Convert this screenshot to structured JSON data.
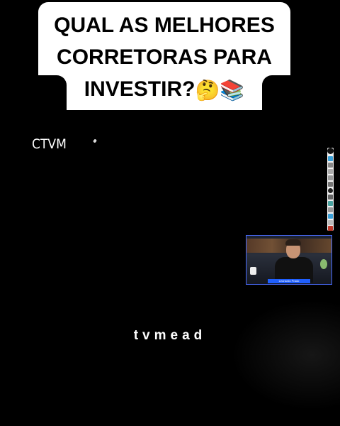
{
  "caption": {
    "line1": "QUAL AS MELHORES",
    "line2": "CORRETORAS PARA",
    "line3": "INVESTIR?",
    "emojis": "🤔📚"
  },
  "handwriting": {
    "text": "CTVM"
  },
  "webcam": {
    "nameplate": "Leonardo Prado"
  },
  "watermark": {
    "text": "tvmead"
  },
  "toolbar": {
    "tools": [
      "pointer-icon",
      "pen-icon",
      "highlighter-icon",
      "eraser-icon",
      "shape-icon",
      "text-icon",
      "color-dot-icon",
      "undo-icon",
      "grid-icon",
      "clear-icon",
      "settings-icon"
    ]
  },
  "colors": {
    "background": "#000000",
    "caption_bg": "#ffffff",
    "webcam_border": "#4a6cff"
  }
}
